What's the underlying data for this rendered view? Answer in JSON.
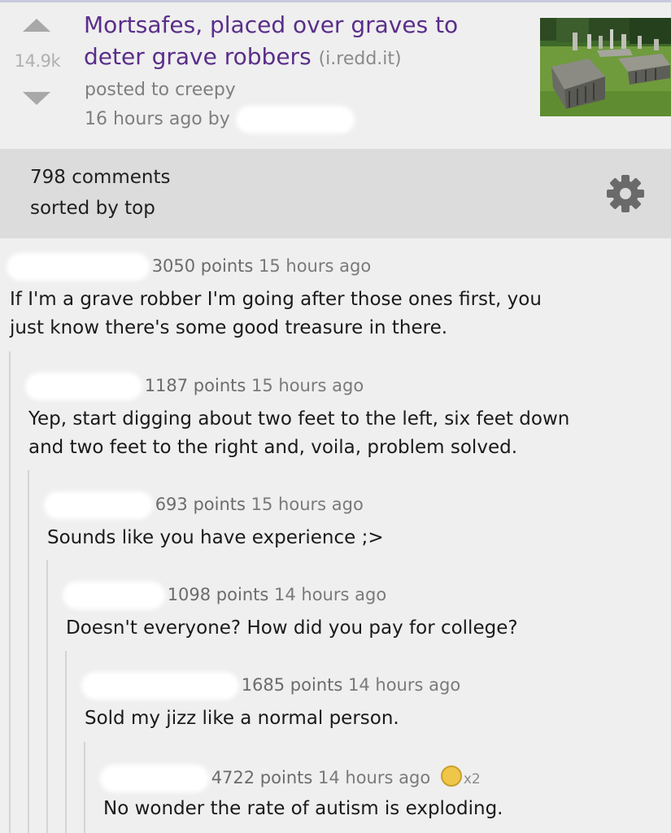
{
  "post": {
    "score": "14.9k",
    "title": "Mortsafes, placed over graves to deter grave robbers",
    "domain": "(i.redd.it)",
    "posted_to": "posted to creepy",
    "time_by": "16 hours ago by"
  },
  "comments_bar": {
    "count": "798 comments",
    "sort": "sorted by top"
  },
  "comments": [
    {
      "points": "3050 points",
      "age": "15 hours ago",
      "body_lines": [
        "If I'm a grave robber I'm going after those ones first, you",
        "just know there's some good treasure in there."
      ]
    },
    {
      "points": "1187 points",
      "age": "15 hours ago",
      "body_lines": [
        "Yep, start digging about two feet to the left, six feet down",
        "and two feet to the right and, voila, problem solved."
      ]
    },
    {
      "points": "693 points",
      "age": "15 hours ago",
      "body_lines": [
        "Sounds like you have experience ;>"
      ]
    },
    {
      "points": "1098 points",
      "age": "14 hours ago",
      "body_lines": [
        "Doesn't everyone? How did you pay for college?"
      ]
    },
    {
      "points": "1685 points",
      "age": "14 hours ago",
      "body_lines": [
        "Sold my jizz like a normal person."
      ]
    },
    {
      "points": "4722 points",
      "age": "14 hours ago",
      "gilded": "x2",
      "body_lines": [
        "No wonder the rate of autism is exploding."
      ]
    }
  ],
  "colors": {
    "title": "#5a2e8a",
    "background": "#efefef",
    "bar": "#dcdcdc"
  }
}
